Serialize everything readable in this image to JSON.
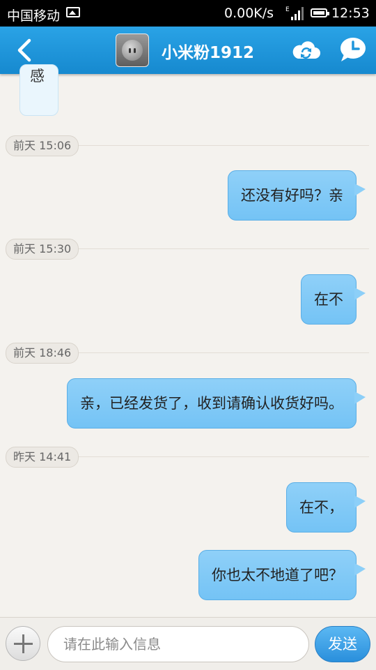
{
  "status_bar": {
    "carrier": "中国移动",
    "network_speed": "0.00K/s",
    "network_type": "E",
    "time": "12:53"
  },
  "header": {
    "contact_name": "小米粉1912"
  },
  "chat": {
    "previous_message_fragment": "感",
    "messages": [
      {
        "timestamp": "前天 15:06",
        "text": "还没有好吗？亲"
      },
      {
        "timestamp": "前天 15:30",
        "text": "在不"
      },
      {
        "timestamp": "前天 18:46",
        "text": "亲，已经发货了，收到请确认收货好吗。"
      },
      {
        "timestamp": "昨天 14:41",
        "text": "在不，"
      },
      {
        "timestamp": "",
        "text": "你也太不地道了吧？"
      }
    ]
  },
  "input_bar": {
    "placeholder": "请在此输入信息",
    "send_label": "发送"
  },
  "colors": {
    "title_bar": "#1e96dc",
    "bubble": "#7fc8f6",
    "background": "#f4f2ee"
  }
}
